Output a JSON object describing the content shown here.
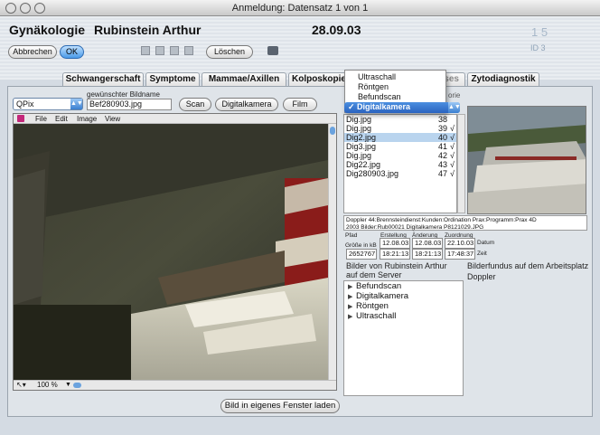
{
  "window": {
    "title": "Anmeldung: Datensatz 1 von 1"
  },
  "header": {
    "department": "Gynäkologie",
    "patient": "Rubinstein Arthur",
    "date": "28.09.03",
    "record_number": "1 5",
    "id_label": "ID 3"
  },
  "toolbar": {
    "cancel_label": "Abbrechen",
    "ok_label": "OK",
    "delete_label": "Löschen"
  },
  "tabs": [
    "Schwangerschaft",
    "Symptome",
    "Mammae/Axillen",
    "Kolposkopie",
    "Diverses",
    "Zytodiagnostik"
  ],
  "capture": {
    "source_select": "QPix",
    "filename_label": "gewünschter Bildname",
    "filename_value": "Bef280903.jpg",
    "scan_label": "Scan",
    "camera_label": "Digitalkamera",
    "film_label": "Film",
    "category_label_fragment": "orie"
  },
  "viewer": {
    "menu": [
      "File",
      "Edit",
      "Image",
      "View"
    ],
    "zoom": "100 %",
    "open_window_label": "Bild in eigenes Fenster laden"
  },
  "dropdown": {
    "options": [
      "Ultraschall",
      "Röntgen",
      "Befundscan",
      "Digitalkamera"
    ],
    "selected": "Digitalkamera",
    "selected_mark": "✓"
  },
  "files": [
    {
      "name": "Dig.jpg",
      "num": "38",
      "check": ""
    },
    {
      "name": "Dig.jpg",
      "num": "39",
      "check": "√"
    },
    {
      "name": "Dig2.jpg",
      "num": "40",
      "check": "√"
    },
    {
      "name": "Dig3.jpg",
      "num": "41",
      "check": "√"
    },
    {
      "name": "Dig.jpg",
      "num": "42",
      "check": "√"
    },
    {
      "name": "Dig22.jpg",
      "num": "43",
      "check": "√"
    },
    {
      "name": "Dig280903.jpg",
      "num": "47",
      "check": "√"
    }
  ],
  "info": {
    "path_line1": "Doppler 44:Brennsteindienst:Kunden:Ordination Prax:Programm:Prax 4D",
    "path_line2": "2003 Bilder:Rub00021 Digitalkamera P8121029.JPG",
    "pfad_label": "Pfad",
    "size_label": "Größe in kB",
    "size_value": "2652767",
    "created_label": "Erstellung",
    "modified_label": "Änderung",
    "assigned_label": "Zuordnung",
    "created_date": "12.08.03",
    "modified_date": "12.08.03",
    "assigned_date": "22.10.03",
    "created_time": "18:21:13",
    "modified_time": "18:21:13",
    "assigned_time": "17:48:37",
    "datum_label": "Datum",
    "zeit_label": "Zeit"
  },
  "server": {
    "title_line1": "Bilder von Rubinstein Arthur",
    "title_line2": "auf dem Server",
    "items": [
      "Befundscan",
      "Digitalkamera",
      "Röntgen",
      "Ultraschall"
    ]
  },
  "workstation": {
    "title": "Bilderfundus auf dem Arbeitsplatz",
    "host": "Doppler"
  }
}
